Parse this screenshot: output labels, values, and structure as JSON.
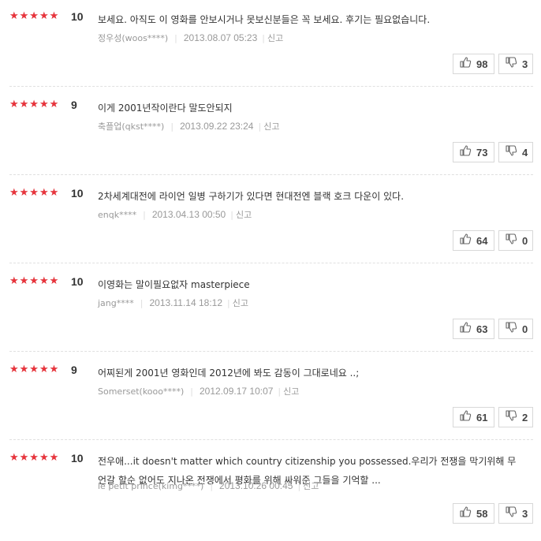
{
  "reviews": [
    {
      "rating": 10,
      "score_label": "10",
      "text": "보세요. 아직도 이 영화를 안보시거나 못보신분들은 꼭 보세요. 후기는 필요없습니다.",
      "author": "정우성(woos****)",
      "date": "2013.08.07 05:23",
      "report": "신고",
      "likes": "98",
      "dislikes": "3"
    },
    {
      "rating": 9,
      "score_label": "9",
      "text": "이게 2001년작이란다 말도안되지",
      "author": "축플업(qkst****)",
      "date": "2013.09.22 23:24",
      "report": "신고",
      "likes": "73",
      "dislikes": "4"
    },
    {
      "rating": 10,
      "score_label": "10",
      "text": "2차세계대전에 라이언 일병 구하기가 있다면 현대전엔 블랙 호크 다운이 있다.",
      "author": "enqk****",
      "date": "2013.04.13 00:50",
      "report": "신고",
      "likes": "64",
      "dislikes": "0"
    },
    {
      "rating": 10,
      "score_label": "10",
      "text": "이영화는 말이필요없자 masterpiece",
      "author": "jang****",
      "date": "2013.11.14 18:12",
      "report": "신고",
      "likes": "63",
      "dislikes": "0"
    },
    {
      "rating": 9,
      "score_label": "9",
      "text": "어찌된게 2001년 영화인데 2012년에 봐도 감동이 그대로네요 ..;",
      "author": "Somerset(kooo****)",
      "date": "2012.09.17 10:07",
      "report": "신고",
      "likes": "61",
      "dislikes": "2"
    },
    {
      "rating": 10,
      "score_label": "10",
      "text": "전우애...it doesn't matter which country citizenship you possessed.우리가 전쟁을 막기위해 무언갈 할순 없어도 지나온 전쟁에서 평화를 위해 싸워준 그들을 기억할 ...",
      "author": "le petit prince(kimg****)",
      "date": "2013.10.26 00:45",
      "report": "신고",
      "likes": "58",
      "dislikes": "3"
    }
  ],
  "colors": {
    "star_filled": "#e8343c",
    "star_empty": "#d9d9d9",
    "meta_text": "#999999"
  },
  "icons": {
    "like": "thumbs-up-icon",
    "dislike": "thumbs-down-icon"
  }
}
